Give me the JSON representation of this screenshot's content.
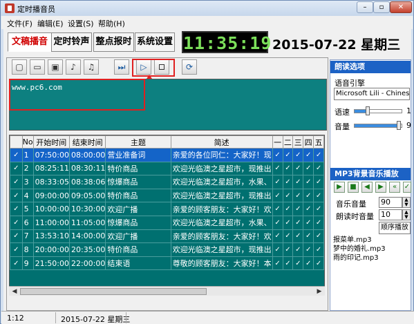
{
  "window": {
    "title": "定时播音员"
  },
  "menu": [
    {
      "label": "文件(F)"
    },
    {
      "label": "编辑(E)"
    },
    {
      "label": "设置(S)"
    },
    {
      "label": "帮助(H)"
    }
  ],
  "tabs": [
    {
      "label": "文稿播音",
      "active": true
    },
    {
      "label": "定时铃声"
    },
    {
      "label": "整点报时"
    },
    {
      "label": "系统设置"
    }
  ],
  "clock": {
    "time": "11:35:19",
    "date": "2015-07-22 星期三"
  },
  "toolbar": {
    "buttons": [
      {
        "icon": "new-document-icon",
        "glyph": "▢"
      },
      {
        "icon": "open-folder-icon",
        "glyph": "▭"
      },
      {
        "icon": "save-icon",
        "glyph": "▣"
      },
      {
        "icon": "music-note-icon",
        "glyph": "♪"
      },
      {
        "icon": "music-notes-icon",
        "glyph": "♫"
      },
      {
        "icon": "next-icon",
        "glyph": "⏭"
      },
      {
        "icon": "play-icon",
        "glyph": "▷"
      },
      {
        "icon": "stop-icon",
        "glyph": ""
      },
      {
        "icon": "refresh-icon",
        "glyph": "⟳"
      }
    ]
  },
  "editor": {
    "text": "www.pc6.com"
  },
  "table": {
    "headers": [
      "No",
      "开始时间",
      "结束时间",
      "主题",
      "简述",
      "一",
      "二",
      "三",
      "四",
      "五"
    ],
    "rows": [
      {
        "no": "1",
        "start": "07:50:00",
        "end": "08:00:00",
        "topic": "营业准备词",
        "summary": "亲爱的各位同仁：大家好！现"
      },
      {
        "no": "2",
        "start": "08:25:11",
        "end": "08:30:11",
        "topic": "特价商品",
        "summary": "欢迎光临澳之星超市，现推出"
      },
      {
        "no": "3",
        "start": "08:33:05",
        "end": "08:38:06",
        "topic": "惊爆商品",
        "summary": "欢迎光临澳之星超市，水果、"
      },
      {
        "no": "4",
        "start": "09:00:00",
        "end": "09:05:00",
        "topic": "特价商品",
        "summary": "欢迎光临澳之星超市，现推出"
      },
      {
        "no": "5",
        "start": "10:00:00",
        "end": "10:30:00",
        "topic": "欢迎广播",
        "summary": "亲爱的顾客朋友：大家好！欢"
      },
      {
        "no": "6",
        "start": "11:00:00",
        "end": "11:05:00",
        "topic": "惊爆商品",
        "summary": "欢迎光临澳之星超市，水果、"
      },
      {
        "no": "7",
        "start": "13:53:10",
        "end": "14:00:00",
        "topic": "欢迎广播",
        "summary": "亲爱的顾客朋友：大家好！欢"
      },
      {
        "no": "8",
        "start": "20:00:00",
        "end": "20:35:00",
        "topic": "特价商品",
        "summary": "欢迎光临澳之星超市，现推出"
      },
      {
        "no": "9",
        "start": "21:50:00",
        "end": "22:00:00",
        "topic": "结束语",
        "summary": "尊敬的顾客朋友：大家好！本"
      }
    ],
    "check_mark": "✓"
  },
  "reading_options": {
    "header": "朗读选项",
    "engine_label": "语音引擎",
    "engine_value": "Microsoft Lili - Chinese (Chin",
    "speed_label": "语速",
    "speed_value": "1",
    "speed_level": 0.3,
    "volume_label": "音量",
    "volume_value": "9",
    "volume_level": 0.95
  },
  "mp3": {
    "header": "MP3背景音乐播放",
    "music_volume_label": "音乐音量",
    "music_volume_value": "90",
    "reading_volume_label": "朗读时音量",
    "reading_volume_value": "10",
    "mode_value": "顺序播放",
    "playlist": [
      "报菜单.mp3",
      "梦中的婚礼.mp3",
      "雨的印记.mp3"
    ]
  },
  "status": {
    "time": "1:12",
    "date": "2015-07-22 星期三"
  }
}
